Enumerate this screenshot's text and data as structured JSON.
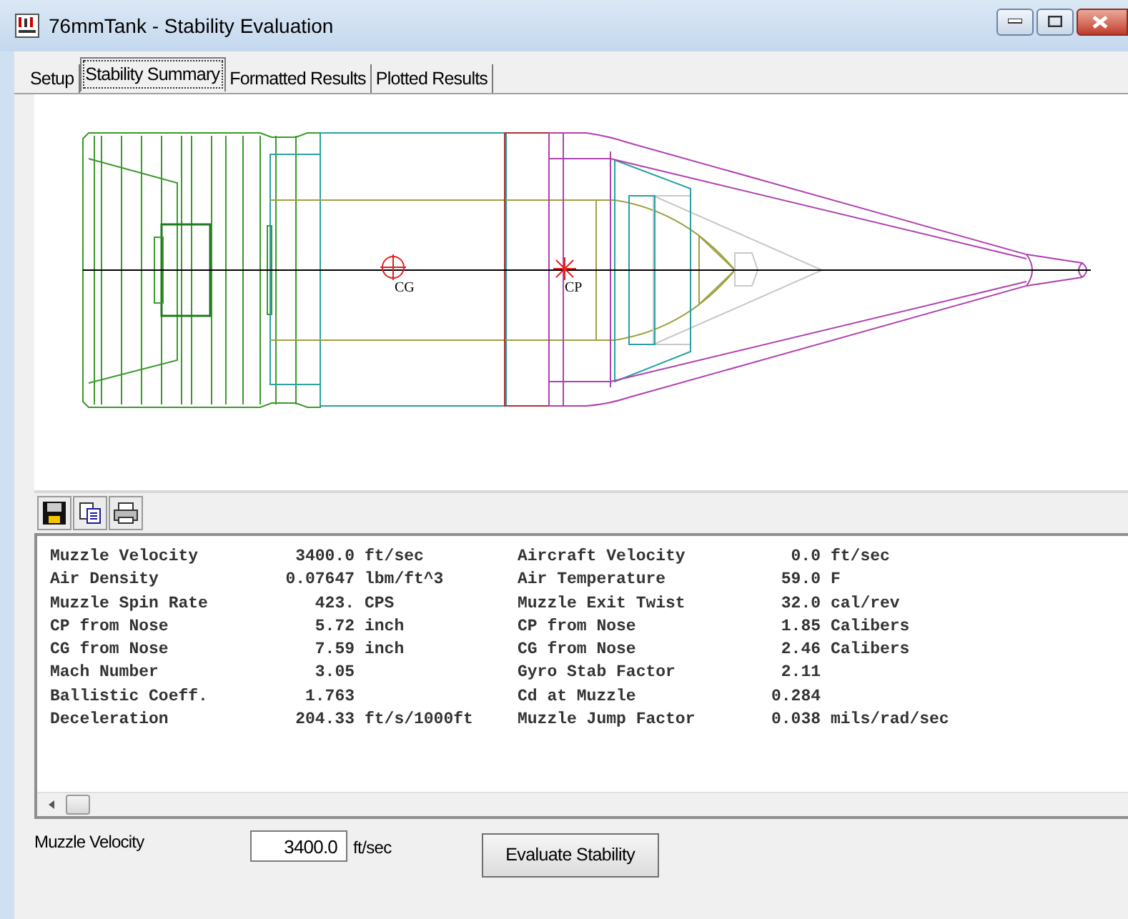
{
  "window": {
    "title": "76mmTank - Stability Evaluation"
  },
  "tabs": [
    {
      "label": "Setup",
      "selected": false
    },
    {
      "label": "Stability Summary",
      "selected": true
    },
    {
      "label": "Formatted Results",
      "selected": false
    },
    {
      "label": "Plotted Results",
      "selected": false
    }
  ],
  "drawing": {
    "cg_label": "CG",
    "cp_label": "CP"
  },
  "results": {
    "left": [
      {
        "label": "Muzzle Velocity",
        "value": "3400.0",
        "unit": "ft/sec"
      },
      {
        "label": "Air Density",
        "value": "0.07647",
        "unit": "lbm/ft^3"
      },
      {
        "label": "Muzzle Spin Rate",
        "value": "423.",
        "unit": "CPS"
      },
      {
        "label": "CP from Nose",
        "value": "5.72",
        "unit": "inch"
      },
      {
        "label": "CG from Nose",
        "value": "7.59",
        "unit": "inch"
      },
      {
        "label": "Mach Number",
        "value": "3.05"
      },
      {
        "label": "Ballistic Coeff.",
        "value": "1.763"
      },
      {
        "label": "Deceleration",
        "value": "204.33",
        "unit": "ft/s/1000ft"
      }
    ],
    "right": [
      {
        "label": "Aircraft Velocity",
        "value": "0.0",
        "unit": "ft/sec"
      },
      {
        "label": "Air Temperature",
        "value": "59.0",
        "unit": "F"
      },
      {
        "label": "Muzzle Exit Twist",
        "value": "32.0",
        "unit": "cal/rev"
      },
      {
        "label": "CP from Nose",
        "value": "1.85",
        "unit": "Calibers"
      },
      {
        "label": "CG from Nose",
        "value": "2.46",
        "unit": "Calibers"
      },
      {
        "label": "Gyro Stab Factor",
        "value": "2.11"
      },
      {
        "label": "Cd at Muzzle",
        "value": "0.284"
      },
      {
        "label": "Muzzle Jump Factor",
        "value": "0.038",
        "unit": "mils/rad/sec"
      }
    ]
  },
  "velocity_input": {
    "label": "Muzzle Velocity",
    "value": "3400.0",
    "unit": "ft/sec"
  },
  "evaluate_button": "Evaluate Stability"
}
